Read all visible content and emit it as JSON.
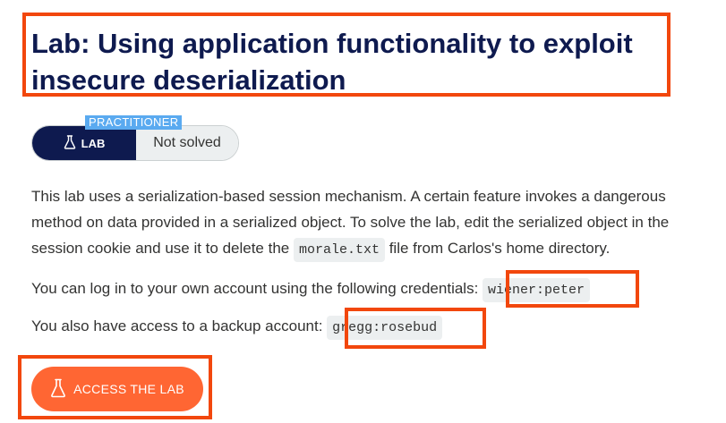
{
  "header": {
    "title": "Lab: Using application functionality to exploit insecure deserialization"
  },
  "badge": {
    "level": "PRACTITIONER",
    "lab_label": "LAB",
    "status": "Not solved"
  },
  "description": {
    "part1": "This lab uses a serialization-based session mechanism. A certain feature invokes a dangerous method on data provided in a serialized object. To solve the lab, edit the serialized object in the session cookie and use it to delete the ",
    "file_code": "morale.txt",
    "part2": " file from Carlos's home directory."
  },
  "credentials": {
    "own_text": "You can log in to your own account using the following credentials: ",
    "own_code": "wiener:peter",
    "backup_text": "You also have access to a backup account: ",
    "backup_code": "gregg:rosebud"
  },
  "action": {
    "access_label": "ACCESS THE LAB"
  },
  "colors": {
    "highlight": "#f2470d",
    "title": "#0e1a4f",
    "button": "#ff6633",
    "level_badge": "#5aaaf0"
  }
}
